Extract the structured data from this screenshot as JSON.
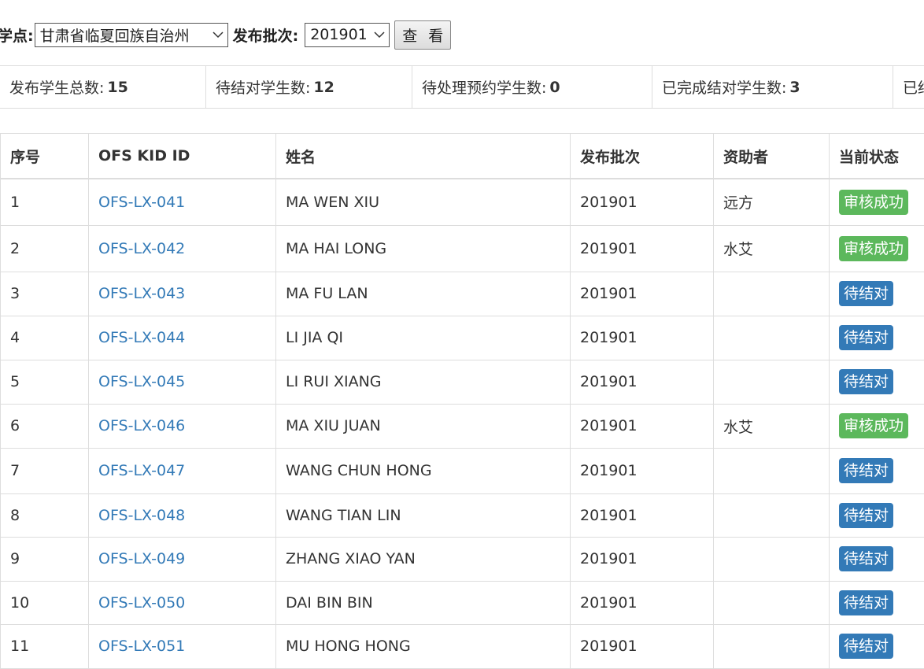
{
  "filters": {
    "site_label": "助学点:",
    "site_value": "甘肃省临夏回族自治州",
    "batch_label": "发布批次:",
    "batch_value": "201901",
    "view_button": "查 看"
  },
  "stats": [
    {
      "label": "发布学生总数:",
      "value": "15"
    },
    {
      "label": "待结对学生数:",
      "value": "12"
    },
    {
      "label": "待处理预约学生数:",
      "value": "0"
    },
    {
      "label": "已完成结对学生数:",
      "value": "3"
    },
    {
      "label": "已结",
      "value": ""
    }
  ],
  "table": {
    "headers": [
      "序号",
      "OFS KID ID",
      "姓名",
      "发布批次",
      "资助者",
      "当前状态"
    ],
    "rows": [
      {
        "no": "1",
        "kid_id": "OFS-LX-041",
        "name": "MA WEN XIU",
        "batch": "201901",
        "sponsor": "远方",
        "status": "审核成功",
        "status_type": "success"
      },
      {
        "no": "2",
        "kid_id": "OFS-LX-042",
        "name": "MA HAI LONG",
        "batch": "201901",
        "sponsor": "水艾",
        "status": "审核成功",
        "status_type": "success"
      },
      {
        "no": "3",
        "kid_id": "OFS-LX-043",
        "name": "MA FU LAN",
        "batch": "201901",
        "sponsor": "",
        "status": "待结对",
        "status_type": "pending"
      },
      {
        "no": "4",
        "kid_id": "OFS-LX-044",
        "name": "LI JIA QI",
        "batch": "201901",
        "sponsor": "",
        "status": "待结对",
        "status_type": "pending"
      },
      {
        "no": "5",
        "kid_id": "OFS-LX-045",
        "name": "LI RUI XIANG",
        "batch": "201901",
        "sponsor": "",
        "status": "待结对",
        "status_type": "pending"
      },
      {
        "no": "6",
        "kid_id": "OFS-LX-046",
        "name": "MA XIU JUAN",
        "batch": "201901",
        "sponsor": "水艾",
        "status": "审核成功",
        "status_type": "success"
      },
      {
        "no": "7",
        "kid_id": "OFS-LX-047",
        "name": "WANG CHUN HONG",
        "batch": "201901",
        "sponsor": "",
        "status": "待结对",
        "status_type": "pending"
      },
      {
        "no": "8",
        "kid_id": "OFS-LX-048",
        "name": "WANG TIAN LIN",
        "batch": "201901",
        "sponsor": "",
        "status": "待结对",
        "status_type": "pending"
      },
      {
        "no": "9",
        "kid_id": "OFS-LX-049",
        "name": "ZHANG XIAO YAN",
        "batch": "201901",
        "sponsor": "",
        "status": "待结对",
        "status_type": "pending"
      },
      {
        "no": "10",
        "kid_id": "OFS-LX-050",
        "name": "DAI BIN BIN",
        "batch": "201901",
        "sponsor": "",
        "status": "待结对",
        "status_type": "pending"
      },
      {
        "no": "11",
        "kid_id": "OFS-LX-051",
        "name": "MU HONG HONG",
        "batch": "201901",
        "sponsor": "",
        "status": "待结对",
        "status_type": "pending"
      }
    ]
  },
  "colors": {
    "link": "#337ab7",
    "success_badge": "#5cb85c",
    "pending_badge": "#337ab7",
    "border": "#dddddd"
  },
  "icons": {
    "select_chevron": "chevron-down-icon"
  }
}
